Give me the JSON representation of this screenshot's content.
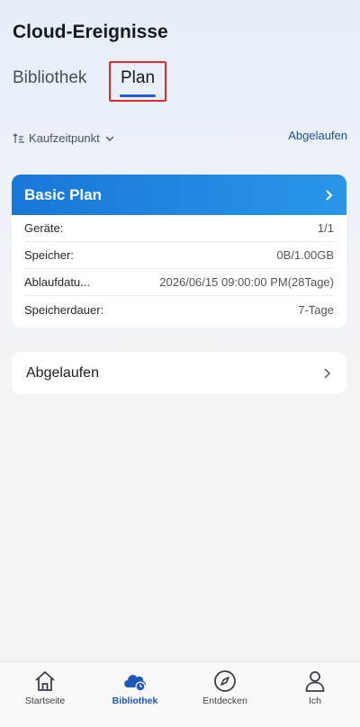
{
  "header": {
    "title": "Cloud-Ereignisse"
  },
  "tabs": [
    {
      "label": "Bibliothek"
    },
    {
      "label": "Plan"
    }
  ],
  "sort": {
    "label": "Kaufzeitpunkt"
  },
  "expired_link": "Abgelaufen",
  "plan_card": {
    "name": "Basic Plan",
    "rows": [
      {
        "label": "Geräte:",
        "value": "1/1"
      },
      {
        "label": "Speicher:",
        "value": "0B/1.00GB"
      },
      {
        "label": "Ablaufdatu...",
        "value": "2026/06/15 09:00:00 PM(28Tage)"
      },
      {
        "label": "Speicherdauer:",
        "value": "7-Tage"
      }
    ]
  },
  "expired_card": {
    "label": "Abgelaufen"
  },
  "bottom_nav": [
    {
      "label": "Startseite",
      "icon": "home-icon"
    },
    {
      "label": "Bibliothek",
      "icon": "cloud-library-icon"
    },
    {
      "label": "Entdecken",
      "icon": "compass-icon"
    },
    {
      "label": "Ich",
      "icon": "person-icon"
    }
  ],
  "colors": {
    "accent": "#1d5bd6",
    "plan_header_start": "#1877d8",
    "plan_header_end": "#2a96e8",
    "highlight_border": "#e0292f",
    "link": "#1e4f9c"
  }
}
